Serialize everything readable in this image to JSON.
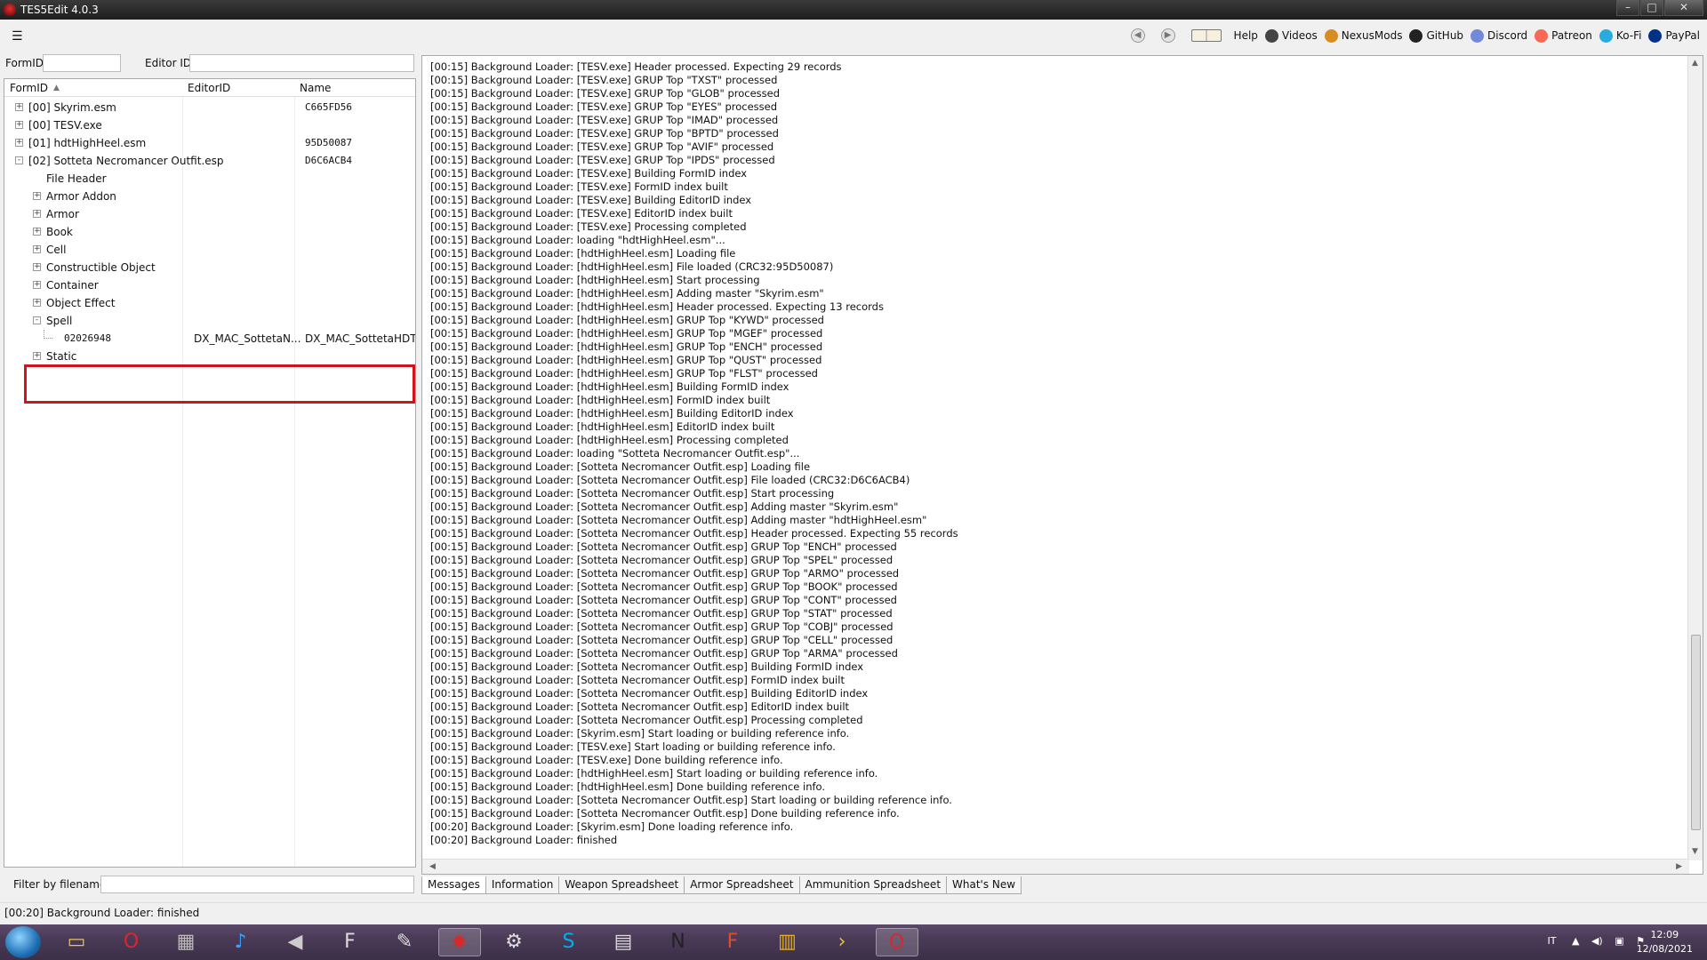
{
  "window": {
    "title": "TES5Edit 4.0.3",
    "buttons": [
      "–",
      "□",
      "✕"
    ]
  },
  "toolbar": {
    "links": [
      {
        "label": "Help",
        "icon": "help-book-icon",
        "color": "#8a6a2e"
      },
      {
        "label": "Videos",
        "icon": "videos-icon",
        "color": "#444444"
      },
      {
        "label": "NexusMods",
        "icon": "nexusmods-icon",
        "color": "#d98c1f"
      },
      {
        "label": "GitHub",
        "icon": "github-icon",
        "color": "#222222"
      },
      {
        "label": "Discord",
        "icon": "discord-icon",
        "color": "#7289da"
      },
      {
        "label": "Patreon",
        "icon": "patreon-icon",
        "color": "#f96854"
      },
      {
        "label": "Ko-Fi",
        "icon": "kofi-icon",
        "color": "#29abe0"
      },
      {
        "label": "PayPal",
        "icon": "paypal-icon",
        "color": "#003087"
      }
    ]
  },
  "filters": {
    "formid_label": "FormID",
    "editorid_label": "Editor ID",
    "formid_value": "",
    "editorid_value": ""
  },
  "tree": {
    "columns": [
      "FormID",
      "EditorID",
      "Name"
    ],
    "rows": [
      {
        "indent": 0,
        "expander": "+",
        "label": "[00] Skyrim.esm",
        "name": "C665FD56"
      },
      {
        "indent": 0,
        "expander": "+",
        "label": "[00] TESV.exe",
        "name": ""
      },
      {
        "indent": 0,
        "expander": "+",
        "label": "[01] hdtHighHeel.esm",
        "name": "95D50087"
      },
      {
        "indent": 0,
        "expander": "-",
        "label": "[02] Sotteta Necromancer Outfit.esp",
        "name": "D6C6ACB4"
      },
      {
        "indent": 1,
        "expander": "",
        "label": "File Header",
        "name": ""
      },
      {
        "indent": 1,
        "expander": "+",
        "label": "Armor Addon",
        "name": ""
      },
      {
        "indent": 1,
        "expander": "+",
        "label": "Armor",
        "name": ""
      },
      {
        "indent": 1,
        "expander": "+",
        "label": "Book",
        "name": ""
      },
      {
        "indent": 1,
        "expander": "+",
        "label": "Cell",
        "name": ""
      },
      {
        "indent": 1,
        "expander": "+",
        "label": "Constructible Object",
        "name": ""
      },
      {
        "indent": 1,
        "expander": "+",
        "label": "Container",
        "name": ""
      },
      {
        "indent": 1,
        "expander": "+",
        "label": "Object Effect",
        "name": ""
      },
      {
        "indent": 1,
        "expander": "-",
        "label": "Spell",
        "name": ""
      },
      {
        "indent": 2,
        "expander": "",
        "label": "02026948",
        "editorid": "DX_MAC_SottetaN...",
        "name": "DX_MAC_SottetaHDT"
      },
      {
        "indent": 1,
        "expander": "+",
        "label": "Static",
        "name": ""
      }
    ]
  },
  "bottom_filter": {
    "label": "Filter by filename:",
    "value": ""
  },
  "messages": [
    "[00:15] Background Loader: [TESV.exe] Header processed. Expecting 29 records",
    "[00:15] Background Loader: [TESV.exe] GRUP Top \"TXST\" processed",
    "[00:15] Background Loader: [TESV.exe] GRUP Top \"GLOB\" processed",
    "[00:15] Background Loader: [TESV.exe] GRUP Top \"EYES\" processed",
    "[00:15] Background Loader: [TESV.exe] GRUP Top \"IMAD\" processed",
    "[00:15] Background Loader: [TESV.exe] GRUP Top \"BPTD\" processed",
    "[00:15] Background Loader: [TESV.exe] GRUP Top \"AVIF\" processed",
    "[00:15] Background Loader: [TESV.exe] GRUP Top \"IPDS\" processed",
    "[00:15] Background Loader: [TESV.exe] Building FormID index",
    "[00:15] Background Loader: [TESV.exe] FormID index built",
    "[00:15] Background Loader: [TESV.exe] Building EditorID index",
    "[00:15] Background Loader: [TESV.exe] EditorID index built",
    "[00:15] Background Loader: [TESV.exe] Processing completed",
    "[00:15] Background Loader: loading \"hdtHighHeel.esm\"...",
    "[00:15] Background Loader: [hdtHighHeel.esm] Loading file",
    "[00:15] Background Loader: [hdtHighHeel.esm] File loaded (CRC32:95D50087)",
    "[00:15] Background Loader: [hdtHighHeel.esm] Start processing",
    "[00:15] Background Loader: [hdtHighHeel.esm] Adding master \"Skyrim.esm\"",
    "[00:15] Background Loader: [hdtHighHeel.esm] Header processed. Expecting 13 records",
    "[00:15] Background Loader: [hdtHighHeel.esm] GRUP Top \"KYWD\" processed",
    "[00:15] Background Loader: [hdtHighHeel.esm] GRUP Top \"MGEF\" processed",
    "[00:15] Background Loader: [hdtHighHeel.esm] GRUP Top \"ENCH\" processed",
    "[00:15] Background Loader: [hdtHighHeel.esm] GRUP Top \"QUST\" processed",
    "[00:15] Background Loader: [hdtHighHeel.esm] GRUP Top \"FLST\" processed",
    "[00:15] Background Loader: [hdtHighHeel.esm] Building FormID index",
    "[00:15] Background Loader: [hdtHighHeel.esm] FormID index built",
    "[00:15] Background Loader: [hdtHighHeel.esm] Building EditorID index",
    "[00:15] Background Loader: [hdtHighHeel.esm] EditorID index built",
    "[00:15] Background Loader: [hdtHighHeel.esm] Processing completed",
    "[00:15] Background Loader: loading \"Sotteta Necromancer Outfit.esp\"...",
    "[00:15] Background Loader: [Sotteta Necromancer Outfit.esp] Loading file",
    "[00:15] Background Loader: [Sotteta Necromancer Outfit.esp] File loaded (CRC32:D6C6ACB4)",
    "[00:15] Background Loader: [Sotteta Necromancer Outfit.esp] Start processing",
    "[00:15] Background Loader: [Sotteta Necromancer Outfit.esp] Adding master \"Skyrim.esm\"",
    "[00:15] Background Loader: [Sotteta Necromancer Outfit.esp] Adding master \"hdtHighHeel.esm\"",
    "[00:15] Background Loader: [Sotteta Necromancer Outfit.esp] Header processed. Expecting 55 records",
    "[00:15] Background Loader: [Sotteta Necromancer Outfit.esp] GRUP Top \"ENCH\" processed",
    "[00:15] Background Loader: [Sotteta Necromancer Outfit.esp] GRUP Top \"SPEL\" processed",
    "[00:15] Background Loader: [Sotteta Necromancer Outfit.esp] GRUP Top \"ARMO\" processed",
    "[00:15] Background Loader: [Sotteta Necromancer Outfit.esp] GRUP Top \"BOOK\" processed",
    "[00:15] Background Loader: [Sotteta Necromancer Outfit.esp] GRUP Top \"CONT\" processed",
    "[00:15] Background Loader: [Sotteta Necromancer Outfit.esp] GRUP Top \"STAT\" processed",
    "[00:15] Background Loader: [Sotteta Necromancer Outfit.esp] GRUP Top \"COBJ\" processed",
    "[00:15] Background Loader: [Sotteta Necromancer Outfit.esp] GRUP Top \"CELL\" processed",
    "[00:15] Background Loader: [Sotteta Necromancer Outfit.esp] GRUP Top \"ARMA\" processed",
    "[00:15] Background Loader: [Sotteta Necromancer Outfit.esp] Building FormID index",
    "[00:15] Background Loader: [Sotteta Necromancer Outfit.esp] FormID index built",
    "[00:15] Background Loader: [Sotteta Necromancer Outfit.esp] Building EditorID index",
    "[00:15] Background Loader: [Sotteta Necromancer Outfit.esp] EditorID index built",
    "[00:15] Background Loader: [Sotteta Necromancer Outfit.esp] Processing completed",
    "[00:15] Background Loader: [Skyrim.esm] Start loading or building reference info.",
    "[00:15] Background Loader: [TESV.exe] Start loading or building reference info.",
    "[00:15] Background Loader: [TESV.exe] Done building reference info.",
    "[00:15] Background Loader: [hdtHighHeel.esm] Start loading or building reference info.",
    "[00:15] Background Loader: [hdtHighHeel.esm] Done building reference info.",
    "[00:15] Background Loader: [Sotteta Necromancer Outfit.esp] Start loading or building reference info.",
    "[00:15] Background Loader: [Sotteta Necromancer Outfit.esp] Done building reference info.",
    "[00:20] Background Loader: [Skyrim.esm] Done loading reference info.",
    "[00:20] Background Loader: finished"
  ],
  "tabs": [
    {
      "label": "Messages",
      "active": true
    },
    {
      "label": "Information",
      "active": false
    },
    {
      "label": "Weapon Spreadsheet",
      "active": false
    },
    {
      "label": "Armor Spreadsheet",
      "active": false
    },
    {
      "label": "Ammunition Spreadsheet",
      "active": false
    },
    {
      "label": "What's New",
      "active": false
    }
  ],
  "status": {
    "text": "[00:20] Background Loader: finished"
  },
  "taskbar": {
    "apps": [
      {
        "name": "file-explorer-icon",
        "glyph": "▭",
        "color": "#e8c35a"
      },
      {
        "name": "opera-icon",
        "glyph": "O",
        "color": "#e0242b"
      },
      {
        "name": "media-center-icon",
        "glyph": "▦",
        "color": "#bbbbbb"
      },
      {
        "name": "music-app-icon",
        "glyph": "♪",
        "color": "#3aa0ff"
      },
      {
        "name": "volume-app-icon",
        "glyph": "◀",
        "color": "#cccccc"
      },
      {
        "name": "ffdec-icon",
        "glyph": "F",
        "color": "#dddddd"
      },
      {
        "name": "pen-tool-icon",
        "glyph": "✎",
        "color": "#dddddd"
      },
      {
        "name": "tes5edit-taskbar-icon",
        "glyph": "✹",
        "color": "#d62a2a",
        "active": true
      },
      {
        "name": "utility-icon",
        "glyph": "⚙",
        "color": "#dddddd"
      },
      {
        "name": "skype-icon",
        "glyph": "S",
        "color": "#00aff0"
      },
      {
        "name": "window-icon",
        "glyph": "▤",
        "color": "#dddddd"
      },
      {
        "name": "nmm-icon",
        "glyph": "N",
        "color": "#222222"
      },
      {
        "name": "f-app-icon",
        "glyph": "F",
        "color": "#e14b2a"
      },
      {
        "name": "calendar-app-icon",
        "glyph": "▥",
        "color": "#e8b020"
      },
      {
        "name": "arrow-app-icon",
        "glyph": "›",
        "color": "#e8c040"
      },
      {
        "name": "opera-active-icon",
        "glyph": "O",
        "color": "#e0242b",
        "active": true
      }
    ],
    "tray": {
      "lang": "IT",
      "time": "12:09",
      "date": "12/08/2021"
    }
  }
}
